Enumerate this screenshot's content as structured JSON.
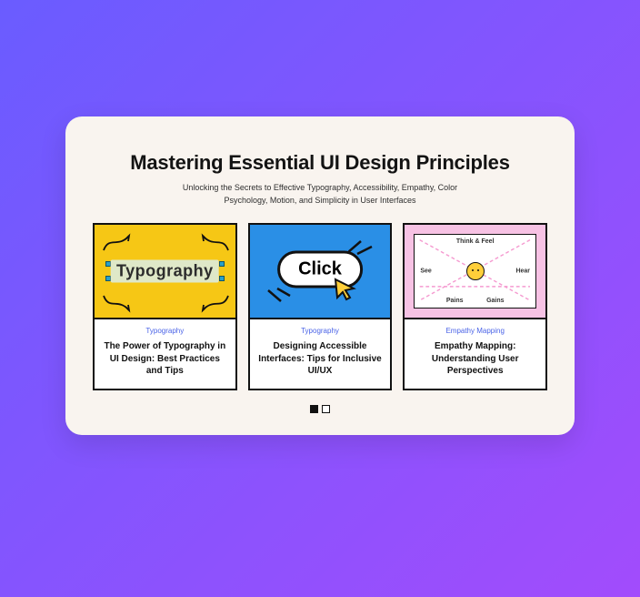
{
  "header": {
    "title": "Mastering Essential UI Design Principles",
    "subtitle": "Unlocking the Secrets to Effective Typography, Accessibility, Empathy, Color Psychology, Motion, and Simplicity in User Interfaces"
  },
  "cards": [
    {
      "category": "Typography",
      "title": "The Power of Typography in UI Design: Best Practices and Tips",
      "art_text": "Typography"
    },
    {
      "category": "Typography",
      "title": "Designing Accessible Interfaces: Tips for Inclusive UI/UX",
      "art_text": "Click"
    },
    {
      "category": "Empathy Mapping",
      "title": "Empathy Mapping: Understanding User Perspectives",
      "labels": {
        "top": "Think & Feel",
        "left": "See",
        "right": "Hear",
        "bottom_left": "Pains",
        "bottom_right": "Gains"
      }
    }
  ],
  "pager": {
    "total": 2,
    "active": 0
  }
}
